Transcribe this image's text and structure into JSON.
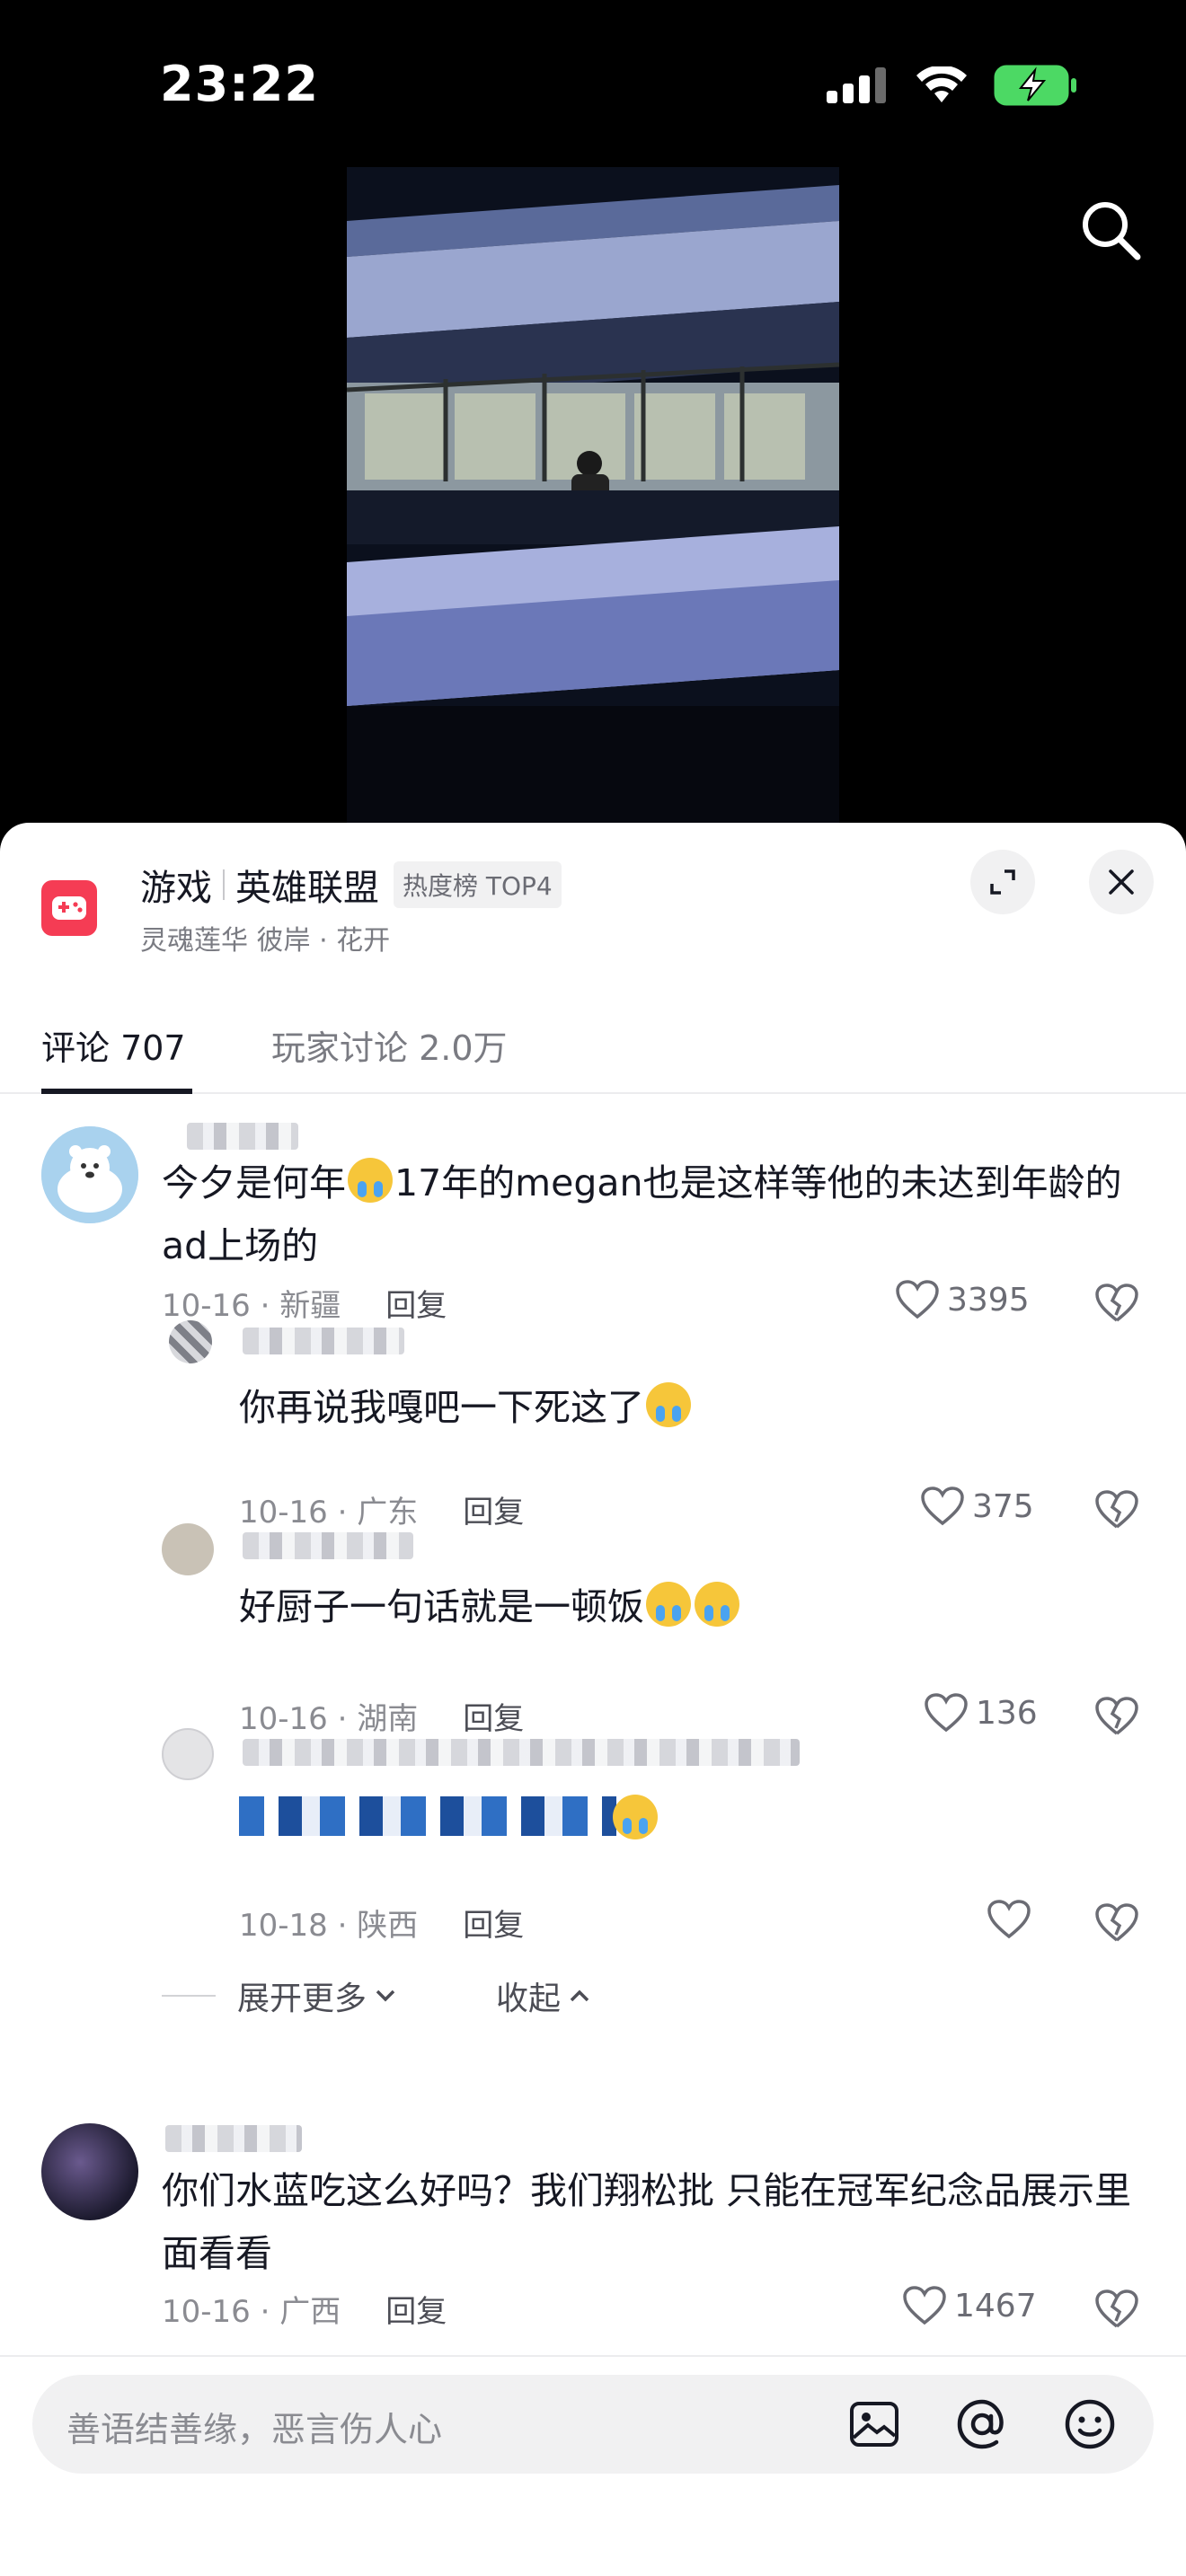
{
  "status_bar": {
    "time": "23:22"
  },
  "header": {
    "category": "游戏",
    "game_name": "英雄联盟",
    "hot_tag": "热度榜 TOP4",
    "subtitle": "灵魂莲华 彼岸 · 花开"
  },
  "tabs": [
    {
      "label": "评论 707",
      "active": true
    },
    {
      "label": "玩家讨论 2.0万",
      "active": false
    }
  ],
  "comments": [
    {
      "text": "今夕是何年",
      "text_after_emoji": "17年的megan也是这样等他的未达到年龄的ad上场的",
      "date_location": "10-16 · 新疆",
      "reply_label": "回复",
      "likes": "3395",
      "replies": [
        {
          "text": "你再说我嘎吧一下死这了",
          "date_location": "10-16 · 广东",
          "reply_label": "回复",
          "likes": "375"
        },
        {
          "text": "好厨子一句话就是一顿饭",
          "date_location": "10-16 · 湖南",
          "reply_label": "回复",
          "likes": "136"
        },
        {
          "text": "",
          "date_location": "10-18 · 陕西",
          "reply_label": "回复",
          "likes": ""
        }
      ],
      "expand_label": "展开更多",
      "collapse_label": "收起"
    },
    {
      "text": "你们水蓝吃这么好吗？我们翔松批 只能在冠军纪念品展示里面看看",
      "date_location": "10-16 · 广西",
      "reply_label": "回复",
      "likes": "1467"
    }
  ],
  "input": {
    "placeholder": "善语结善缘，恶言伤人心"
  },
  "colors": {
    "accent": "#f53c54",
    "text_primary": "#161823",
    "text_secondary": "#8a8b91"
  }
}
